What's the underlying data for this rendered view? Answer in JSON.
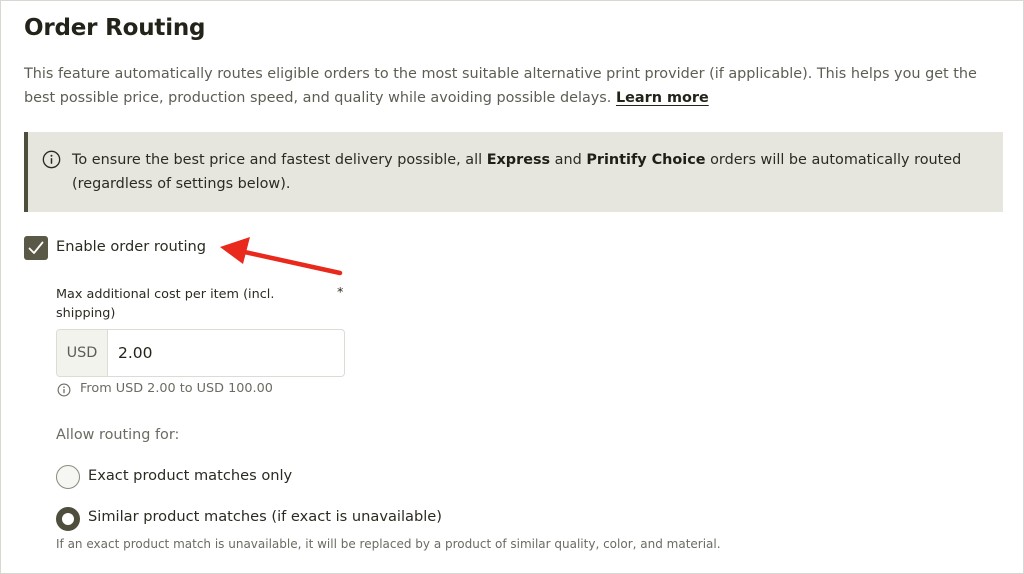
{
  "page": {
    "title": "Order Routing",
    "description": "This feature automatically routes eligible orders to the most suitable alternative print provider (if applicable). This helps you get the best possible price, production speed, and quality while avoiding possible delays. ",
    "learn_more": "Learn more"
  },
  "notice": {
    "icon": "info-circle-icon",
    "text_before": "To ensure the best price and fastest delivery possible, all ",
    "express": "Express",
    "and": " and ",
    "printify_choice": "Printify Choice",
    "text_after": " orders will be automatically routed (regardless of settings below)."
  },
  "routing": {
    "enable_label": "Enable order routing",
    "enabled": true,
    "annotation_color": "#e8291c"
  },
  "max_cost": {
    "label": "Max additional cost per item (incl. shipping)",
    "required_marker": "*",
    "currency": "USD",
    "value": "2.00",
    "hint": "From USD 2.00 to USD 100.00"
  },
  "allow_routing": {
    "label": "Allow routing for:",
    "options": [
      {
        "label": "Exact product matches only",
        "selected": false
      },
      {
        "label": "Similar product matches (if exact is unavailable)",
        "selected": true
      }
    ],
    "similar_hint": "If an exact product match is unavailable, it will be replaced by a product of similar quality, color, and material."
  },
  "colors": {
    "accent": "#4f4e3d",
    "notice_bg": "#e6e6de",
    "text": "#2b2b22",
    "muted": "#6c6b62"
  }
}
